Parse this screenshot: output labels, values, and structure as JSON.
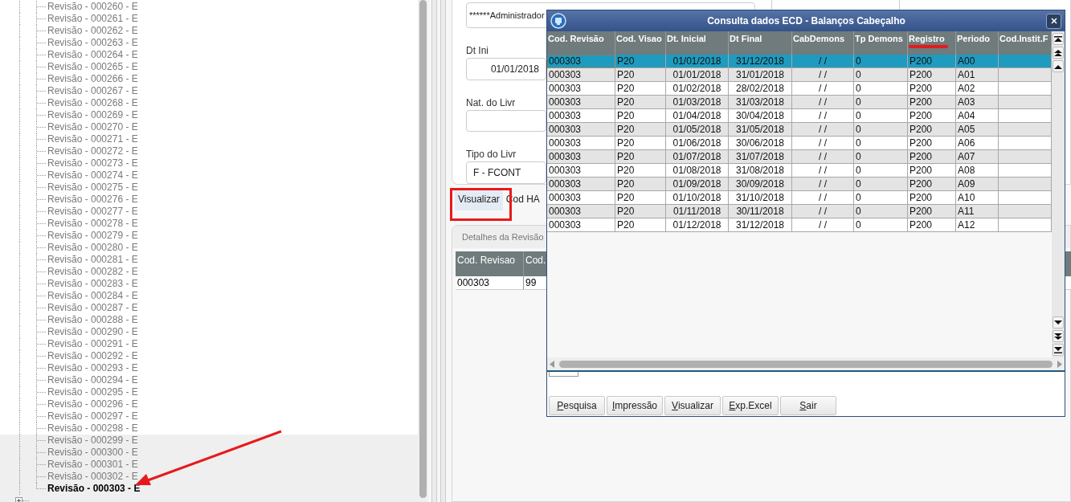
{
  "tree": {
    "revisions": [
      {
        "label": "Revisão - 000260 - E",
        "selected": false
      },
      {
        "label": "Revisão - 000261 - E",
        "selected": false
      },
      {
        "label": "Revisão - 000262 - E",
        "selected": false
      },
      {
        "label": "Revisão - 000263 - E",
        "selected": false
      },
      {
        "label": "Revisão - 000264 - E",
        "selected": false
      },
      {
        "label": "Revisão - 000265 - E",
        "selected": false
      },
      {
        "label": "Revisão - 000266 - E",
        "selected": false
      },
      {
        "label": "Revisão - 000267 - E",
        "selected": false
      },
      {
        "label": "Revisão - 000268 - E",
        "selected": false
      },
      {
        "label": "Revisão - 000269 - E",
        "selected": false
      },
      {
        "label": "Revisão - 000270 - E",
        "selected": false
      },
      {
        "label": "Revisão - 000271 - E",
        "selected": false
      },
      {
        "label": "Revisão - 000272 - E",
        "selected": false
      },
      {
        "label": "Revisão - 000273 - E",
        "selected": false
      },
      {
        "label": "Revisão - 000274 - E",
        "selected": false
      },
      {
        "label": "Revisão - 000275 - E",
        "selected": false
      },
      {
        "label": "Revisão - 000276 - E",
        "selected": false
      },
      {
        "label": "Revisão - 000277 - E",
        "selected": false
      },
      {
        "label": "Revisão - 000278 - E",
        "selected": false
      },
      {
        "label": "Revisão - 000279 - E",
        "selected": false
      },
      {
        "label": "Revisão - 000280 - E",
        "selected": false
      },
      {
        "label": "Revisão - 000281 - E",
        "selected": false
      },
      {
        "label": "Revisão - 000282 - E",
        "selected": false
      },
      {
        "label": "Revisão - 000283 - E",
        "selected": false
      },
      {
        "label": "Revisão - 000284 - E",
        "selected": false
      },
      {
        "label": "Revisão - 000287 - E",
        "selected": false
      },
      {
        "label": "Revisão - 000288 - E",
        "selected": false
      },
      {
        "label": "Revisão - 000290 - E",
        "selected": false
      },
      {
        "label": "Revisão - 000291 - E",
        "selected": false
      },
      {
        "label": "Revisão - 000292 - E",
        "selected": false
      },
      {
        "label": "Revisão - 000293 - E",
        "selected": false
      },
      {
        "label": "Revisão - 000294 - E",
        "selected": false
      },
      {
        "label": "Revisão - 000295 - E",
        "selected": false
      },
      {
        "label": "Revisão - 000296 - E",
        "selected": false
      },
      {
        "label": "Revisão - 000297 - E",
        "selected": false
      },
      {
        "label": "Revisão - 000298 - E",
        "selected": false
      },
      {
        "label": "Revisão - 000299 - E",
        "selected": false
      },
      {
        "label": "Revisão - 000300 - E",
        "selected": false
      },
      {
        "label": "Revisão - 000301 - E",
        "selected": false
      },
      {
        "label": "Revisão - 000302 - E",
        "selected": false
      },
      {
        "label": "Revisão - 000303 - E",
        "selected": true
      }
    ],
    "next_node": {
      "expanded": false
    }
  },
  "form": {
    "user_field": {
      "value": "******Administrador"
    },
    "fields": [
      {
        "label": "Dt Ini",
        "value": "01/01/2018"
      },
      {
        "label": "Nat. do Livr"
      },
      {
        "label": "Tipo do Livr",
        "value": "F - FCONT"
      }
    ],
    "tabs": [
      {
        "label": "Visualizar",
        "selected": true
      },
      {
        "label": "Cod HA",
        "selected": false
      }
    ]
  },
  "details": {
    "title": "Detalhes da Revisão",
    "columns": [
      "Cod. Revisao",
      "Cod."
    ],
    "rows": [
      [
        "000303",
        "99"
      ]
    ]
  },
  "dialog": {
    "title": "Consulta dados ECD - Balanços Cabeçalho",
    "columns": [
      "Cod. Revisão",
      "Cod. Visao",
      "Dt. Inicial",
      "Dt Final",
      "CabDemons",
      "Tp Demons",
      "Registro",
      "Periodo",
      "Cod.Instit.F"
    ],
    "rows": [
      {
        "selected": true,
        "cells": [
          "000303",
          "P20",
          "01/01/2018",
          "31/12/2018",
          "/  /",
          "0",
          "P200",
          "A00",
          ""
        ]
      },
      {
        "selected": false,
        "cells": [
          "000303",
          "P20",
          "01/01/2018",
          "31/01/2018",
          "/  /",
          "0",
          "P200",
          "A01",
          ""
        ]
      },
      {
        "selected": false,
        "cells": [
          "000303",
          "P20",
          "01/02/2018",
          "28/02/2018",
          "/  /",
          "0",
          "P200",
          "A02",
          ""
        ]
      },
      {
        "selected": false,
        "cells": [
          "000303",
          "P20",
          "01/03/2018",
          "31/03/2018",
          "/  /",
          "0",
          "P200",
          "A03",
          ""
        ]
      },
      {
        "selected": false,
        "cells": [
          "000303",
          "P20",
          "01/04/2018",
          "30/04/2018",
          "/  /",
          "0",
          "P200",
          "A04",
          ""
        ]
      },
      {
        "selected": false,
        "cells": [
          "000303",
          "P20",
          "01/05/2018",
          "31/05/2018",
          "/  /",
          "0",
          "P200",
          "A05",
          ""
        ]
      },
      {
        "selected": false,
        "cells": [
          "000303",
          "P20",
          "01/06/2018",
          "30/06/2018",
          "/  /",
          "0",
          "P200",
          "A06",
          ""
        ]
      },
      {
        "selected": false,
        "cells": [
          "000303",
          "P20",
          "01/07/2018",
          "31/07/2018",
          "/  /",
          "0",
          "P200",
          "A07",
          ""
        ]
      },
      {
        "selected": false,
        "cells": [
          "000303",
          "P20",
          "01/08/2018",
          "31/08/2018",
          "/  /",
          "0",
          "P200",
          "A08",
          ""
        ]
      },
      {
        "selected": false,
        "cells": [
          "000303",
          "P20",
          "01/09/2018",
          "30/09/2018",
          "/  /",
          "0",
          "P200",
          "A09",
          ""
        ]
      },
      {
        "selected": false,
        "cells": [
          "000303",
          "P20",
          "01/10/2018",
          "31/10/2018",
          "/  /",
          "0",
          "P200",
          "A10",
          ""
        ]
      },
      {
        "selected": false,
        "cells": [
          "000303",
          "P20",
          "01/11/2018",
          "30/11/2018",
          "/  /",
          "0",
          "P200",
          "A11",
          ""
        ]
      },
      {
        "selected": false,
        "cells": [
          "000303",
          "P20",
          "01/12/2018",
          "31/12/2018",
          "/  /",
          "0",
          "P200",
          "A12",
          ""
        ]
      }
    ],
    "buttons": [
      "Pesquisa",
      "Impressão",
      "Visualizar",
      "Exp.Excel",
      "Sair"
    ]
  }
}
